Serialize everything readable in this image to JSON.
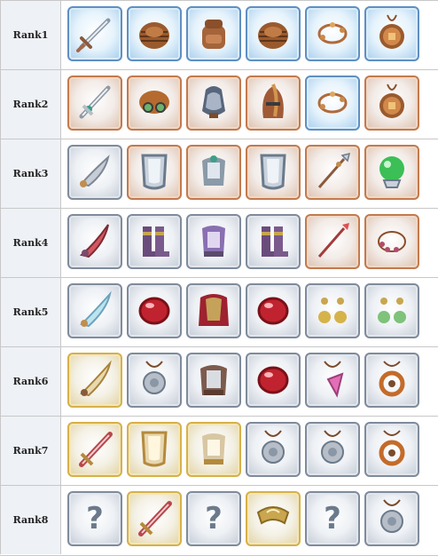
{
  "ranks": [
    {
      "label": "Rank1",
      "items": [
        {
          "icon": "sword-icon",
          "frame": "blue"
        },
        {
          "icon": "wicker-helmet-icon",
          "frame": "blue"
        },
        {
          "icon": "backpack-icon",
          "frame": "blue"
        },
        {
          "icon": "wicker-helmet-icon",
          "frame": "blue"
        },
        {
          "icon": "bracelet-icon",
          "frame": "blue"
        },
        {
          "icon": "clover-amulet-icon",
          "frame": "blue"
        }
      ]
    },
    {
      "label": "Rank2",
      "items": [
        {
          "icon": "ornate-sword-icon",
          "frame": "copper"
        },
        {
          "icon": "goggle-cap-icon",
          "frame": "copper"
        },
        {
          "icon": "hooded-armor-icon",
          "frame": "copper"
        },
        {
          "icon": "crested-helmet-icon",
          "frame": "copper"
        },
        {
          "icon": "bracelet-icon",
          "frame": "blue"
        },
        {
          "icon": "clover-amulet-icon",
          "frame": "copper"
        }
      ]
    },
    {
      "label": "Rank3",
      "items": [
        {
          "icon": "curved-blade-icon",
          "frame": "silver"
        },
        {
          "icon": "shield-icon",
          "frame": "copper"
        },
        {
          "icon": "plate-armor-icon",
          "frame": "copper"
        },
        {
          "icon": "shield-icon",
          "frame": "copper"
        },
        {
          "icon": "spear-icon",
          "frame": "copper"
        },
        {
          "icon": "crystal-orb-icon",
          "frame": "copper"
        }
      ]
    },
    {
      "label": "Rank4",
      "items": [
        {
          "icon": "demon-blade-icon",
          "frame": "silver"
        },
        {
          "icon": "boots-icon",
          "frame": "silver"
        },
        {
          "icon": "violet-armor-icon",
          "frame": "silver"
        },
        {
          "icon": "boots-icon",
          "frame": "silver"
        },
        {
          "icon": "red-spear-icon",
          "frame": "copper"
        },
        {
          "icon": "bead-bracelet-icon",
          "frame": "copper"
        }
      ]
    },
    {
      "label": "Rank5",
      "items": [
        {
          "icon": "feather-blade-icon",
          "frame": "silver"
        },
        {
          "icon": "red-gem-icon",
          "frame": "silver"
        },
        {
          "icon": "caped-armor-icon",
          "frame": "silver"
        },
        {
          "icon": "red-gem-icon",
          "frame": "silver"
        },
        {
          "icon": "gold-earrings-icon",
          "frame": "silver"
        },
        {
          "icon": "green-earrings-icon",
          "frame": "silver"
        }
      ]
    },
    {
      "label": "Rank6",
      "items": [
        {
          "icon": "golden-blade-icon",
          "frame": "gold"
        },
        {
          "icon": "lion-pendant-icon",
          "frame": "silver"
        },
        {
          "icon": "heavy-armor-icon",
          "frame": "silver"
        },
        {
          "icon": "red-gem-icon",
          "frame": "silver"
        },
        {
          "icon": "crystal-pendant-icon",
          "frame": "silver"
        },
        {
          "icon": "ring-amulet-icon",
          "frame": "silver"
        }
      ]
    },
    {
      "label": "Rank7",
      "items": [
        {
          "icon": "great-sword-icon",
          "frame": "gold"
        },
        {
          "icon": "gold-shield-icon",
          "frame": "gold"
        },
        {
          "icon": "gold-armor-icon",
          "frame": "gold"
        },
        {
          "icon": "lion-pendant-icon",
          "frame": "silver"
        },
        {
          "icon": "lion-pendant-icon",
          "frame": "silver"
        },
        {
          "icon": "ring-amulet-icon",
          "frame": "silver"
        }
      ]
    },
    {
      "label": "Rank8",
      "items": [
        {
          "icon": "question-mark-icon",
          "frame": "silver"
        },
        {
          "icon": "great-sword-icon",
          "frame": "gold"
        },
        {
          "icon": "question-mark-icon",
          "frame": "silver"
        },
        {
          "icon": "winged-circlet-icon",
          "frame": "gold"
        },
        {
          "icon": "question-mark-icon",
          "frame": "silver"
        },
        {
          "icon": "lion-pendant-icon",
          "frame": "silver"
        }
      ]
    }
  ]
}
